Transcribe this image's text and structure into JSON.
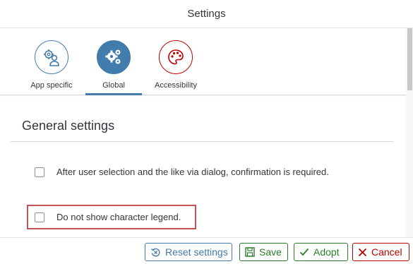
{
  "dialog": {
    "title": "Settings"
  },
  "tabs": [
    {
      "label": "App specific",
      "icon": "user-settings-icon",
      "color": "#427cac"
    },
    {
      "label": "Global",
      "icon": "gears-icon",
      "color": "#427cac",
      "selected": true
    },
    {
      "label": "Accessibility",
      "icon": "palette-icon",
      "color": "#bb0000"
    }
  ],
  "section": {
    "title": "General settings"
  },
  "options": [
    {
      "label": "After user selection and the like via dialog, confirmation is required.",
      "checked": false
    },
    {
      "label": "Do not show character legend.",
      "checked": false,
      "highlighted": true
    }
  ],
  "footer": {
    "reset_label": "Reset settings",
    "save_label": "Save",
    "adopt_label": "Adopt",
    "cancel_label": "Cancel"
  },
  "colors": {
    "accent": "#427cac",
    "positive": "#2b7d2b",
    "negative": "#bb0000",
    "highlight": "#c7515a"
  }
}
